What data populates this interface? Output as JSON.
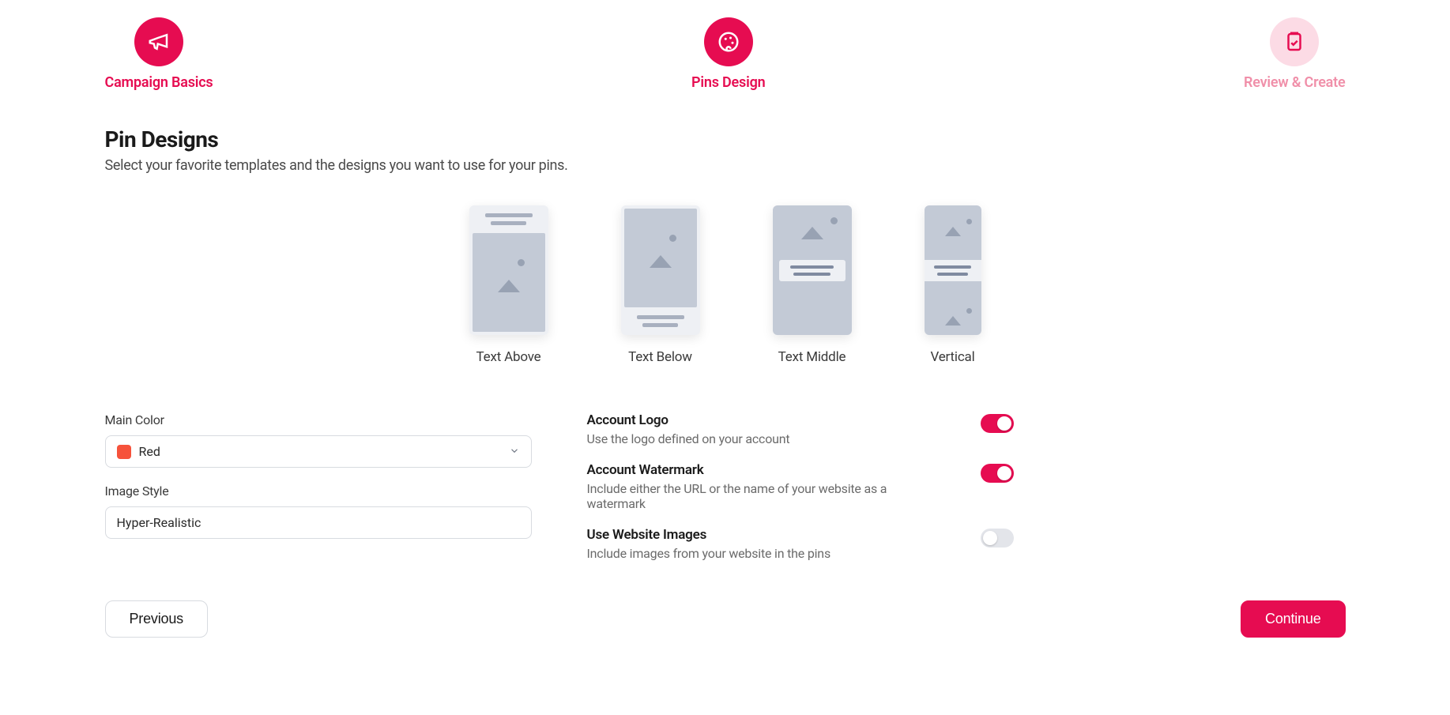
{
  "stepper": {
    "steps": [
      {
        "label": "Campaign Basics",
        "state": "active"
      },
      {
        "label": "Pins Design",
        "state": "active"
      },
      {
        "label": "Review & Create",
        "state": "inactive"
      }
    ]
  },
  "heading": {
    "title": "Pin Designs",
    "subtitle": "Select your favorite templates and the designs you want to use for your pins."
  },
  "templates": [
    {
      "label": "Text Above"
    },
    {
      "label": "Text Below"
    },
    {
      "label": "Text Middle"
    },
    {
      "label": "Vertical"
    }
  ],
  "form": {
    "mainColor": {
      "label": "Main Color",
      "valueLabel": "Red",
      "swatchHex": "#f6523b"
    },
    "imageStyle": {
      "label": "Image Style",
      "value": "Hyper-Realistic"
    }
  },
  "options": {
    "accountLogo": {
      "title": "Account Logo",
      "desc": "Use the logo defined on your account",
      "on": true
    },
    "accountWatermark": {
      "title": "Account Watermark",
      "desc": "Include either the URL or the name of your website as a watermark",
      "on": true
    },
    "useWebsiteImages": {
      "title": "Use Website Images",
      "desc": "Include images from your website in the pins",
      "on": false
    }
  },
  "footer": {
    "previous": "Previous",
    "continue": "Continue"
  },
  "colors": {
    "brand": "#e60c51"
  }
}
